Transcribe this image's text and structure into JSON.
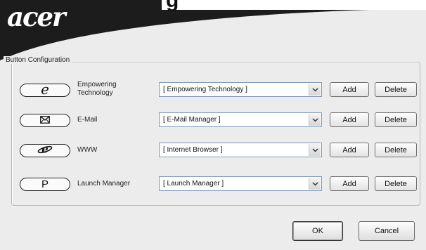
{
  "window": {
    "title_fragment": "g",
    "logo_text": "acer"
  },
  "group": {
    "label": "Button Configuration"
  },
  "rows": [
    {
      "icon": "e-icon",
      "glyph": "e",
      "label_line1": "Empowering",
      "label_line2": "Technology",
      "selected": "[ Empowering Technology ]",
      "add_label": "Add",
      "delete_label": "Delete"
    },
    {
      "icon": "envelope-icon",
      "glyph": "✉",
      "label_line1": "E-Mail",
      "label_line2": "",
      "selected": "[ E-Mail Manager ]",
      "add_label": "Add",
      "delete_label": "Delete"
    },
    {
      "icon": "internet-explorer-icon",
      "glyph": "ℯ",
      "label_line1": "WWW",
      "label_line2": "",
      "selected": "[ Internet Browser ]",
      "add_label": "Add",
      "delete_label": "Delete"
    },
    {
      "icon": "p-icon",
      "glyph": "P",
      "label_line1": "Launch Manager",
      "label_line2": "",
      "selected": "[ Launch Manager ]",
      "add_label": "Add",
      "delete_label": "Delete"
    }
  ],
  "footer": {
    "ok_label": "OK",
    "cancel_label": "Cancel"
  },
  "colors": {
    "banner": "#1c1c1c",
    "background": "#ececec",
    "combo_border": "#7f9db9"
  }
}
